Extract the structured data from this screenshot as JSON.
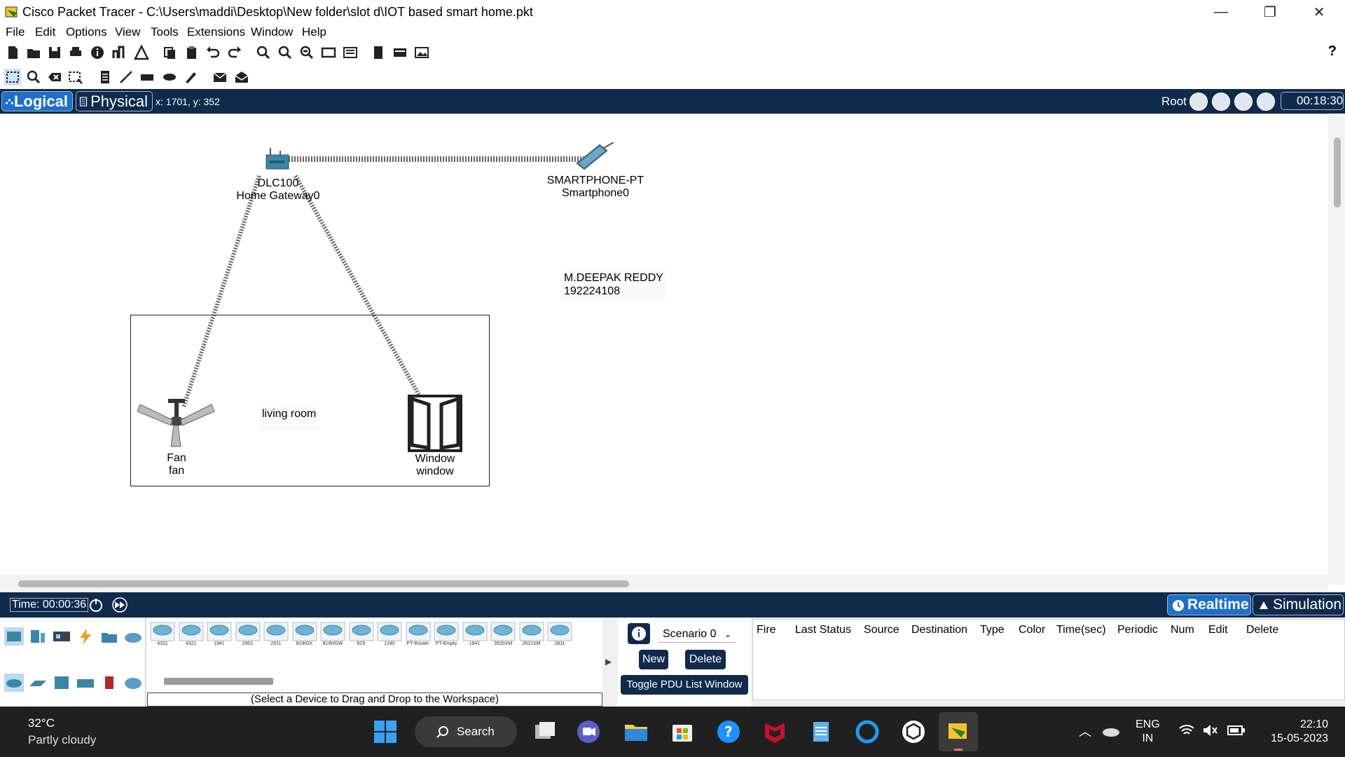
{
  "window": {
    "title": "Cisco Packet Tracer - C:\\Users\\maddi\\Desktop\\New folder\\slot d\\IOT based smart home.pkt",
    "minimize": "—",
    "maximize": "❐",
    "close": "✕"
  },
  "menu": [
    "File",
    "Edit",
    "Options",
    "View",
    "Tools",
    "Extensions",
    "Window",
    "Help"
  ],
  "toolbar": {
    "help": "?"
  },
  "modebar": {
    "logical": "Logical",
    "physical": "Physical",
    "coords": "x: 1701, y: 352",
    "root": "Root",
    "clock": "00:18:30"
  },
  "workspace": {
    "devices": [
      {
        "line1": "DLC100",
        "line2": "Home Gateway0"
      },
      {
        "line1": "SMARTPHONE-PT",
        "line2": "Smartphone0"
      },
      {
        "line1": "Fan",
        "line2": "fan"
      },
      {
        "line1": "Window",
        "line2": "window"
      }
    ],
    "notes": {
      "author_name": "M.DEEPAK REDDY",
      "author_id": "192224108",
      "room": "living room"
    }
  },
  "timebar": {
    "time": "Time: 00:00:36",
    "realtime": "Realtime",
    "simulation": "Simulation"
  },
  "device_panel": {
    "devices": [
      "4331",
      "4321",
      "1941",
      "2901",
      "2911",
      "819IOX",
      "819HGW",
      "829",
      "1240",
      "PT-Router",
      "PT-Empty",
      "1841",
      "2620XM",
      "2621XM",
      "2811"
    ],
    "hint": "(Select a Device to Drag and Drop to the Workspace)"
  },
  "scenario": {
    "selected": "Scenario 0",
    "new": "New",
    "delete": "Delete",
    "toggle": "Toggle PDU List Window"
  },
  "pdu_columns": [
    "Fire",
    "Last Status",
    "Source",
    "Destination",
    "Type",
    "Color",
    "Time(sec)",
    "Periodic",
    "Num",
    "Edit",
    "Delete"
  ],
  "taskbar": {
    "temp": "32°C",
    "weather": "Partly cloudy",
    "search": "Search",
    "lang1": "ENG",
    "lang2": "IN",
    "time": "22:10",
    "date": "15-05-2023"
  },
  "colors": {
    "header_bg": "#102a4c",
    "active_tab": "#1e6fc9",
    "taskbar": "#202020"
  }
}
